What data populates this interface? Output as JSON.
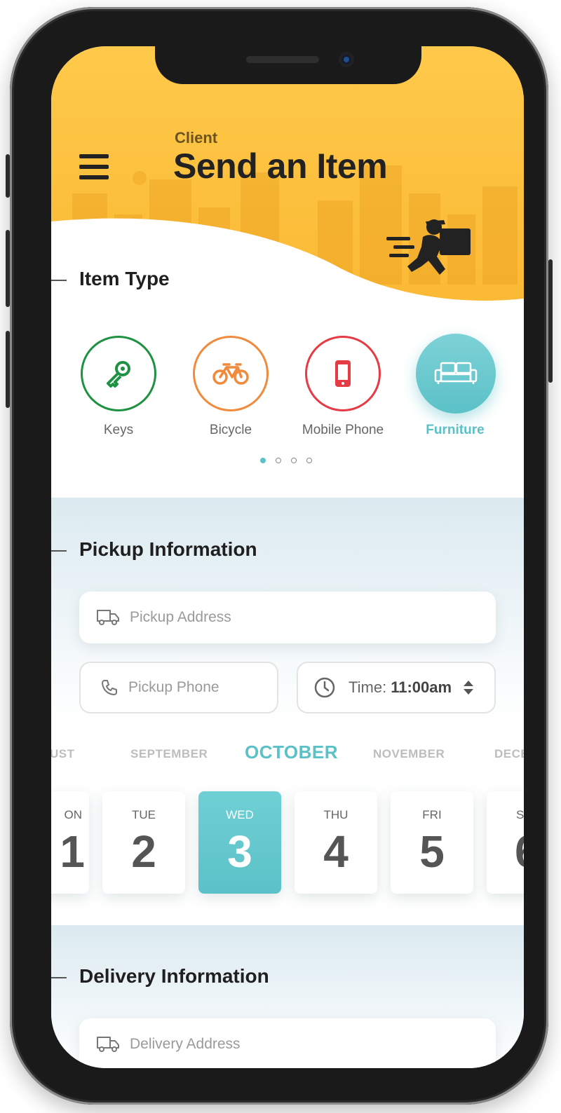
{
  "header": {
    "subtitle": "Client",
    "title": "Send an Item"
  },
  "item_type": {
    "title": "Item Type",
    "items": [
      {
        "label": "Keys",
        "color": "#1e9242",
        "icon": "key-icon"
      },
      {
        "label": "Bicycle",
        "color": "#f08a3c",
        "icon": "bicycle-icon"
      },
      {
        "label": "Mobile Phone",
        "color": "#e43b45",
        "icon": "mobile-phone-icon"
      },
      {
        "label": "Furniture",
        "color": "#5bc1c8",
        "icon": "sofa-icon",
        "selected": true
      }
    ],
    "pages": 4,
    "current_page": 1
  },
  "pickup": {
    "title": "Pickup Information",
    "address_placeholder": "Pickup Address",
    "phone_placeholder": "Pickup Phone",
    "time_label": "Time:",
    "time_value": "11:00am"
  },
  "calendar": {
    "months": [
      "UST",
      "SEPTEMBER",
      "OCTOBER",
      "NOVEMBER",
      "DECE"
    ],
    "selected_month": "OCTOBER",
    "days": [
      {
        "name": "ON",
        "num": "1"
      },
      {
        "name": "TUE",
        "num": "2"
      },
      {
        "name": "WED",
        "num": "3",
        "selected": true
      },
      {
        "name": "THU",
        "num": "4"
      },
      {
        "name": "FRI",
        "num": "5"
      },
      {
        "name": "S",
        "num": "6"
      }
    ]
  },
  "delivery": {
    "title": "Delivery Information",
    "address_placeholder": "Delivery Address"
  },
  "colors": {
    "accent": "#5bc1c8",
    "header": "#fbbf3c"
  }
}
